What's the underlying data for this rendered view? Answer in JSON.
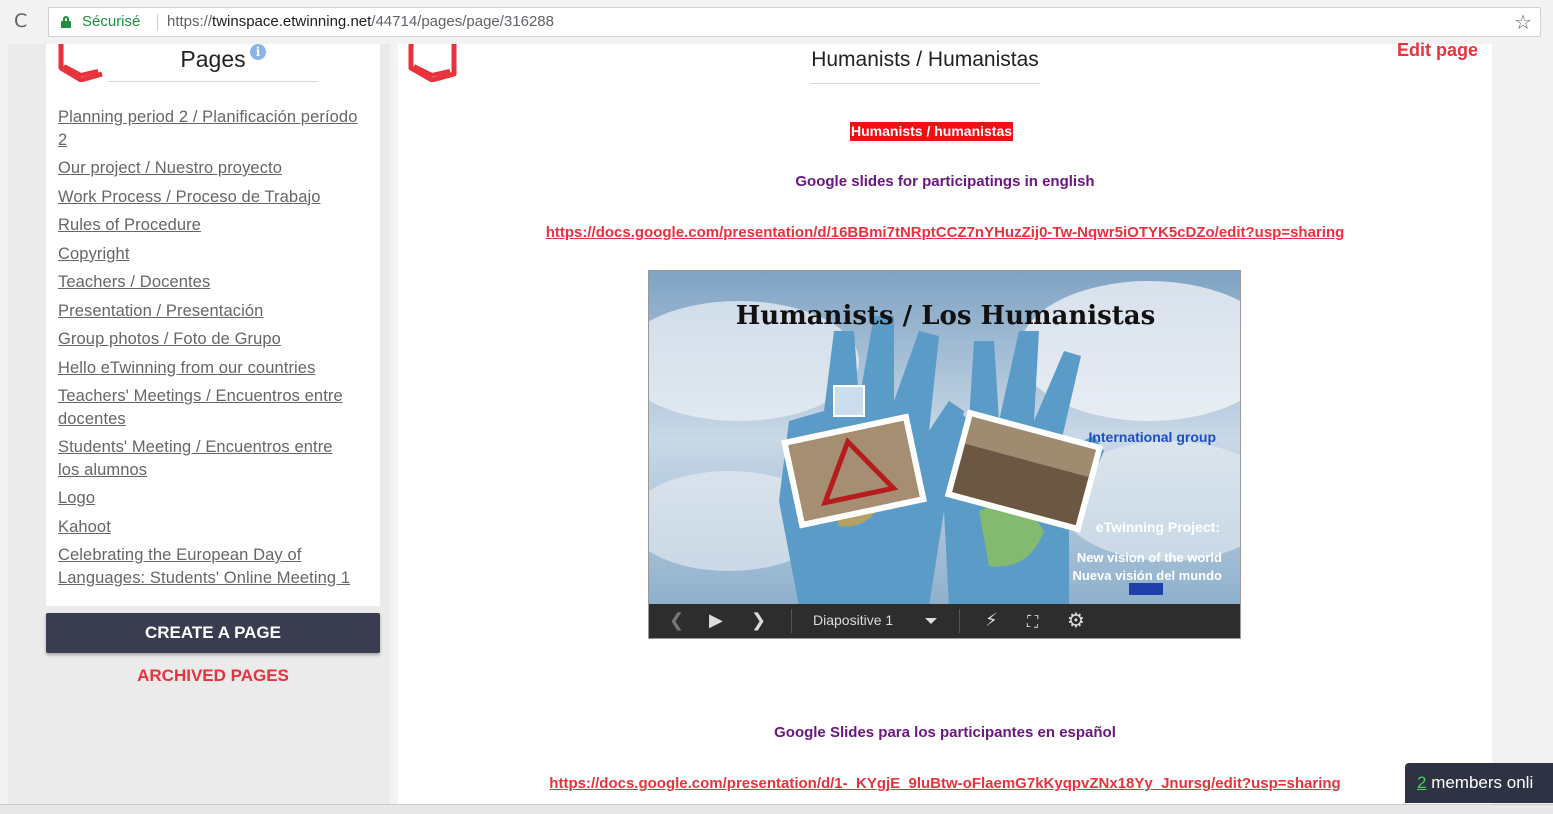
{
  "browser": {
    "secure_label": "Sécurisé",
    "url_scheme": "https://",
    "url_host": "twinspace.etwinning.net",
    "url_path": "/44714/pages/page/316288"
  },
  "sidebar": {
    "title": "Pages",
    "info_glyph": "i",
    "items": [
      "Planning period 2 / Planificación período 2",
      "Our project / Nuestro proyecto",
      "Work Process / Proceso de Trabajo",
      "Rules of Procedure",
      "Copyright",
      "Teachers / Docentes",
      "Presentation / Presentación",
      "Group photos / Foto de Grupo",
      "Hello eTwinning from our countries",
      "Teachers' Meetings / Encuentros entre docentes",
      "Students' Meeting / Encuentros entre los alumnos",
      "Logo",
      "Kahoot",
      "Celebrating the European Day of Languages: Students' Online Meeting 1"
    ],
    "create_button": "CREATE A PAGE",
    "archived_link": "ARCHIVED PAGES"
  },
  "main": {
    "page_title": "Humanists / Humanistas",
    "edit_link": "Edit page",
    "highlight_heading": "Humanists / humanistas",
    "slides_en_label": "Google slides for participatings in english",
    "slides_en_url": "https://docs.google.com/presentation/d/16BBmi7tNRptCCZ7nYHuzZij0-Tw-Nqwr5iOTYK5cDZo/edit?usp=sharing",
    "slides_es_label": "Google Slides para los participantes en español",
    "slides_es_url": "https://docs.google.com/presentation/d/1-_KYgjE_9luBtw-oFlaemG7kKyqpvZNx18Yy_Jnursg/edit?usp=sharing"
  },
  "slide": {
    "title": "Humanists / Los Humanistas",
    "international": "International group",
    "etwinning": "eTwinning Project:",
    "vision_en": "New vision of the world",
    "vision_es": "Nueva visión del mundo",
    "slide_counter": "Diapositive 1"
  },
  "chat": {
    "count": "2",
    "label": " members onli"
  },
  "colors": {
    "accent": "#e8323c",
    "purple": "#6b1780",
    "dark_button": "#3a3d50"
  }
}
